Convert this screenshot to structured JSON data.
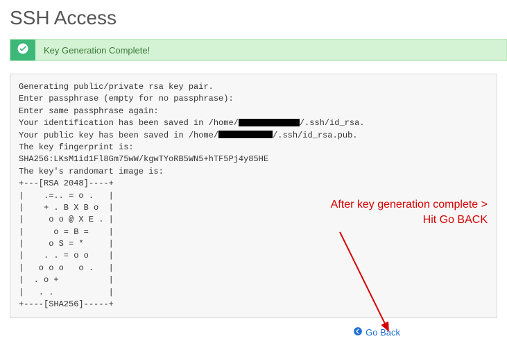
{
  "page": {
    "title": "SSH Access"
  },
  "alert": {
    "message": "Key Generation Complete!"
  },
  "terminal": {
    "line1": "Generating public/private rsa key pair.",
    "line2": "Enter passphrase (empty for no passphrase):",
    "line3": "Enter same passphrase again:",
    "line4_pre": "Your identification has been saved in /home/",
    "line4_post": "/.ssh/id_rsa.",
    "line5_pre": "Your public key has been saved in /home/",
    "line5_post": "/.ssh/id_rsa.pub.",
    "line6": "The key fingerprint is:",
    "line7": "SHA256:LKsM1id1Fl8Gm75wW/kgwTYoRB5WN5+hTF5Pj4y85HE",
    "line8": "The key's randomart image is:",
    "art01": "+---[RSA 2048]----+",
    "art02": "|    .=.. = o .   |",
    "art03": "|    + . B X B o  |",
    "art04": "|     o o @ X E . |",
    "art05": "|      o = B =    |",
    "art06": "|     o S = *     |",
    "art07": "|    . . = o o    |",
    "art08": "|   o o o   o .   |",
    "art09": "|  . o +          |",
    "art10": "|   . .           |",
    "art11": "+----[SHA256]-----+"
  },
  "actions": {
    "go_back": "Go Back"
  },
  "annotation": {
    "line1": "After key generation complete >",
    "line2": "Hit Go BACK"
  }
}
